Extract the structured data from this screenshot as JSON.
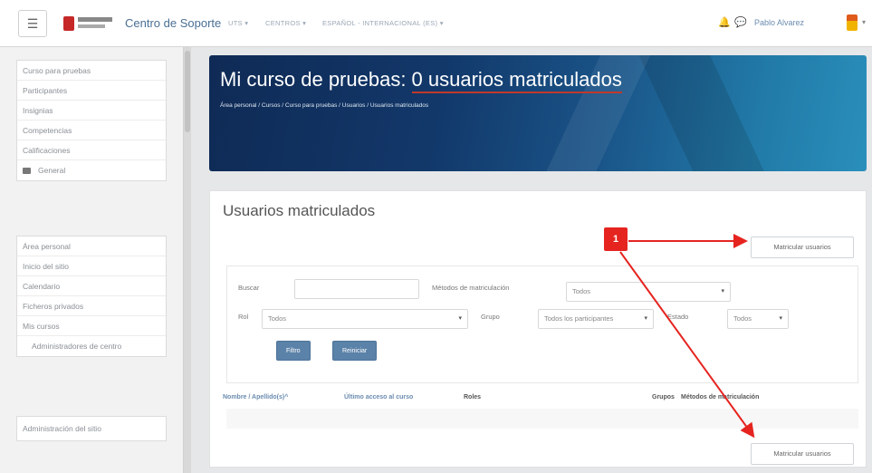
{
  "navbar": {
    "menu_icon": "hamburger-icon",
    "site_name": "Centro de Soporte",
    "menu_items": [
      "UTS ▾",
      "CENTROS ▾",
      "ESPAÑOL - INTERNACIONAL (ES) ▾"
    ],
    "user_name": "Pablo Alvarez",
    "icons": [
      "bell-icon",
      "chat-icon",
      "user-avatar"
    ]
  },
  "drawer": {
    "course_nav": [
      "Curso para pruebas",
      "Participantes",
      "Insignias",
      "Competencias",
      "Calificaciones",
      "General"
    ],
    "site_nav": [
      "Área personal",
      "Inicio del sitio",
      "Calendario",
      "Ficheros privados",
      "Mis cursos",
      "Administradores de centro"
    ],
    "admin_nav": [
      "Administración del sitio"
    ]
  },
  "header": {
    "title_prefix": "Mi curso de pruebas: ",
    "title_highlight": "0 usuarios matriculados",
    "breadcrumb": "Área personal  /  Cursos  /  Curso para pruebas  /  Usuarios  /  Usuarios matriculados"
  },
  "main": {
    "title": "Usuarios matriculados",
    "enrol_button": "Matricular usuarios",
    "filters": {
      "search_label": "Buscar",
      "search_value": "",
      "methods_label": "Métodos de matriculación",
      "methods_value": "Todos",
      "role_label": "Rol",
      "role_value": "Todos",
      "group_label": "Grupo",
      "group_value": "Todos los participantes",
      "status_label": "Estado",
      "status_value": "Todos",
      "filter_button": "Filtro",
      "reset_button": "Reiniciar"
    },
    "table_headers": [
      "Nombre / Apellido(s)^",
      "Último acceso al curso",
      "Roles",
      "Grupos",
      "Métodos de matriculación"
    ]
  },
  "annotation": {
    "badge": "1",
    "accent": "#e52420"
  }
}
